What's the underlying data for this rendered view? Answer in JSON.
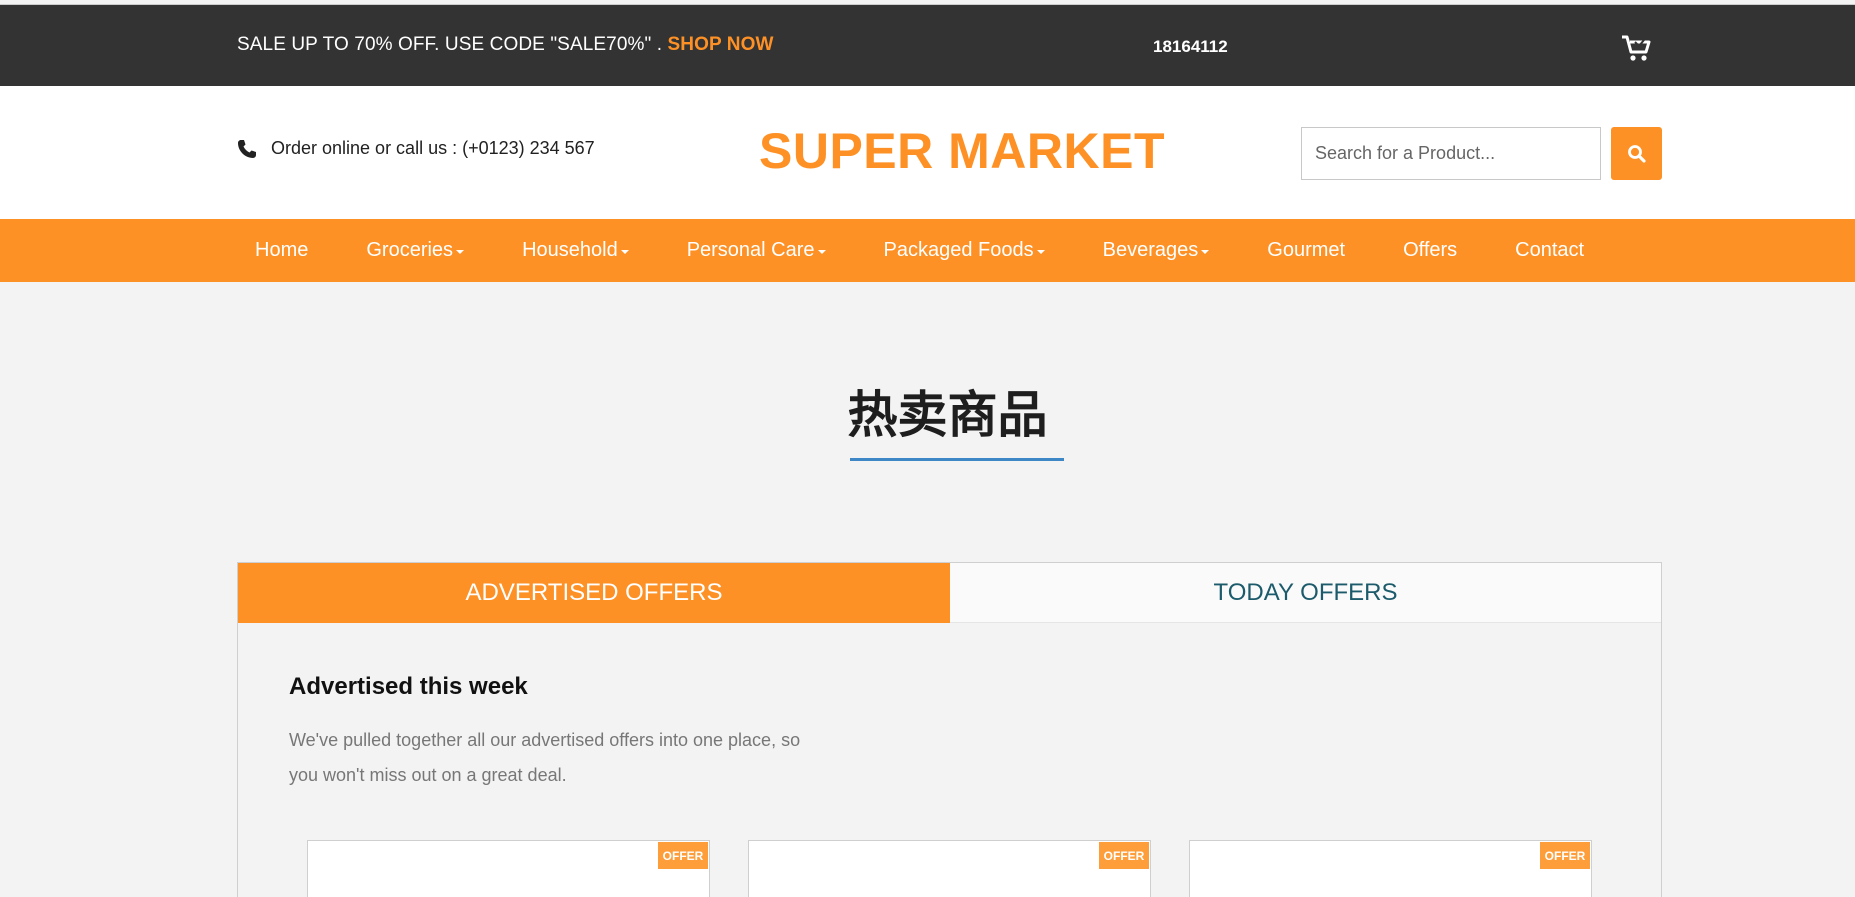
{
  "topbar": {
    "promo_text": "SALE UP TO 70% OFF. USE CODE \"SALE70%\" . ",
    "promo_link": "SHOP NOW",
    "phone_number": "18164112",
    "cart_icon": "cart-icon"
  },
  "header": {
    "call_text": "Order online or call us : (+0123) 234 567",
    "logo": "SUPER MARKET",
    "search_placeholder": "Search for a Product...",
    "search_icon": "search-icon"
  },
  "nav": {
    "items": [
      {
        "label": "Home",
        "dropdown": false
      },
      {
        "label": "Groceries",
        "dropdown": true
      },
      {
        "label": "Household",
        "dropdown": true
      },
      {
        "label": "Personal Care",
        "dropdown": true
      },
      {
        "label": "Packaged Foods",
        "dropdown": true
      },
      {
        "label": "Beverages",
        "dropdown": true
      },
      {
        "label": "Gourmet",
        "dropdown": false
      },
      {
        "label": "Offers",
        "dropdown": false
      },
      {
        "label": "Contact",
        "dropdown": false
      }
    ]
  },
  "section": {
    "title": "热卖商品"
  },
  "tabs": {
    "active": "ADVERTISED OFFERS",
    "inactive": "TODAY OFFERS"
  },
  "advertised": {
    "title": "Advertised this week",
    "description": "We've pulled together all our advertised offers into one place, so you won't miss out on a great deal."
  },
  "cards": [
    {
      "badge": "OFFER",
      "thumb_color": "#e07a2c"
    },
    {
      "badge": "OFFER",
      "thumb_color": "#d9b24a"
    },
    {
      "badge": "OFFER",
      "thumb_color": "#c8c8c8"
    }
  ],
  "colors": {
    "accent": "#fe9126",
    "topbar": "#333333",
    "underline": "#3d87c6",
    "tab_inactive_text": "#1c5b6b"
  }
}
